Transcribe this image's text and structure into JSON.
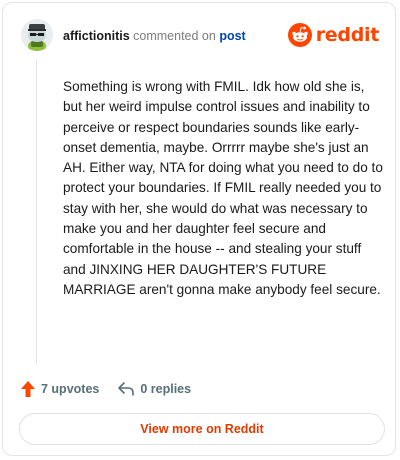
{
  "header": {
    "username": "affictionitis",
    "commented_text": "commented on",
    "post_link": "post",
    "brand": "reddit"
  },
  "comment": {
    "body": "Something is wrong with FMIL. Idk how old she is, but her weird impulse control issues and inability to perceive or respect boundaries sounds like early-onset dementia, maybe. Orrrrr maybe she's just an AH. Either way, NTA for doing what you need to do to protect your boundaries. If FMIL really needed you to stay with her, she would do what was necessary to make you and her daughter feel secure and comfortable in the house -- and stealing your stuff and JINXING HER DAUGHTER'S FUTURE MARRIAGE aren't gonna make anybody feel secure."
  },
  "actions": {
    "upvotes": "7 upvotes",
    "replies": "0 replies"
  },
  "footer": {
    "view_more": "View more on Reddit"
  },
  "colors": {
    "brand": "#ff4500",
    "link": "#0045ac",
    "muted": "#576f76"
  },
  "icons": {
    "avatar": "snoo-avatar",
    "logo": "reddit-alien-icon",
    "upvote": "upvote-arrow-icon",
    "reply": "reply-arrow-icon"
  }
}
